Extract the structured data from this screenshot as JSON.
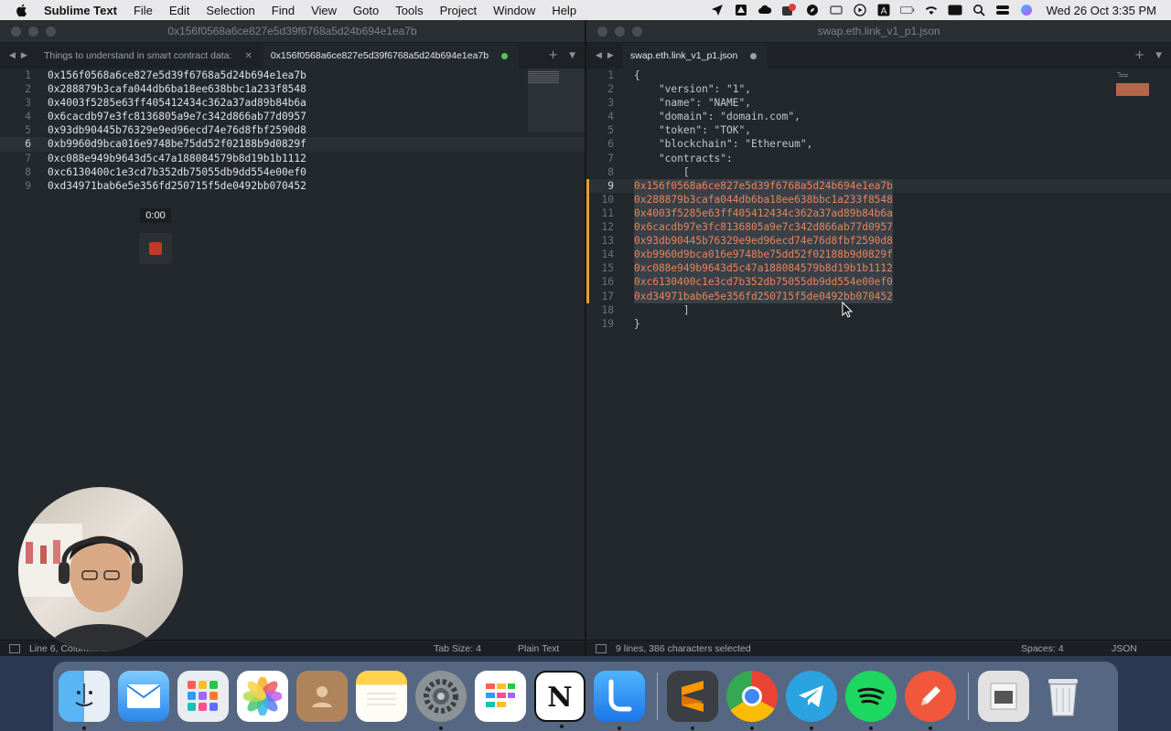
{
  "menubar": {
    "app_name": "Sublime Text",
    "items": [
      "File",
      "Edit",
      "Selection",
      "Find",
      "View",
      "Goto",
      "Tools",
      "Project",
      "Window",
      "Help"
    ],
    "clock": "Wed 26 Oct  3:35 PM"
  },
  "left_pane": {
    "window_title": "0x156f0568a6ce827e5d39f6768a5d24b694e1ea7b",
    "tabs": [
      {
        "label": "Things to understand in smart contract data:",
        "active": false
      },
      {
        "label": "0x156f0568a6ce827e5d39f6768a5d24b694e1ea7b",
        "active": true
      }
    ],
    "lines": [
      "0x156f0568a6ce827e5d39f6768a5d24b694e1ea7b",
      "0x288879b3cafa044db6ba18ee638bbc1a233f8548",
      "0x4003f5285e63ff405412434c362a37ad89b84b6a",
      "0x6cacdb97e3fc8136805a9e7c342d866ab77d0957",
      "0x93db90445b76329e9ed96ecd74e76d8fbf2590d8",
      "0xb9960d9bca016e9748be75dd52f02188b9d0829f",
      "0xc088e949b9643d5c47a188084579b8d19b1b1112",
      "0xc6130400c1e3cd7b352db75055db9dd554e00ef0",
      "0xd34971bab6e5e356fd250715f5de0492bb070452"
    ],
    "current_line": 6,
    "status": {
      "position": "Line 6, Column 43",
      "tab_size": "Tab Size: 4",
      "syntax": "Plain Text"
    }
  },
  "right_pane": {
    "window_title": "swap.eth.link_v1_p1.json",
    "tab_label": "swap.eth.link_v1_p1.json",
    "lines": [
      "{",
      "    \"version\": \"1\",",
      "    \"name\": \"NAME\",",
      "    \"domain\": \"domain.com\",",
      "    \"token\": \"TOK\",",
      "    \"blockchain\": \"Ethereum\",",
      "    \"contracts\":",
      "        [",
      "0x156f0568a6ce827e5d39f6768a5d24b694e1ea7b",
      "0x288879b3cafa044db6ba18ee638bbc1a233f8548",
      "0x4003f5285e63ff405412434c362a37ad89b84b6a",
      "0x6cacdb97e3fc8136805a9e7c342d866ab77d0957",
      "0x93db90445b76329e9ed96ecd74e76d8fbf2590d8",
      "0xb9960d9bca016e9748be75dd52f02188b9d0829f",
      "0xc088e949b9643d5c47a188084579b8d19b1b1112",
      "0xc6130400c1e3cd7b352db75055db9dd554e00ef0",
      "0xd34971bab6e5e356fd250715f5de0492bb070452",
      "        ]",
      "}"
    ],
    "current_line": 9,
    "status": {
      "selection": "9 lines, 386 characters selected",
      "spaces": "Spaces: 4",
      "syntax": "JSON"
    }
  },
  "recorder": {
    "time": "0:00"
  },
  "dock": {
    "apps": [
      "finder-icon",
      "mail-icon",
      "launchpad-icon",
      "photos-icon",
      "contacts-icon",
      "notes-icon",
      "system-preferences-icon",
      "calendar-icon",
      "notion-icon",
      "loom-icon",
      "sublime-text-icon",
      "chrome-icon",
      "telegram-icon",
      "spotify-icon",
      "pencil-icon",
      "downloads-stack-icon",
      "trash-icon"
    ]
  },
  "colors": {
    "editor_bg": "#23282d",
    "selection_marker": "#e1a12f",
    "string": "#a7c98b",
    "hex_highlight": "#e87b44"
  }
}
